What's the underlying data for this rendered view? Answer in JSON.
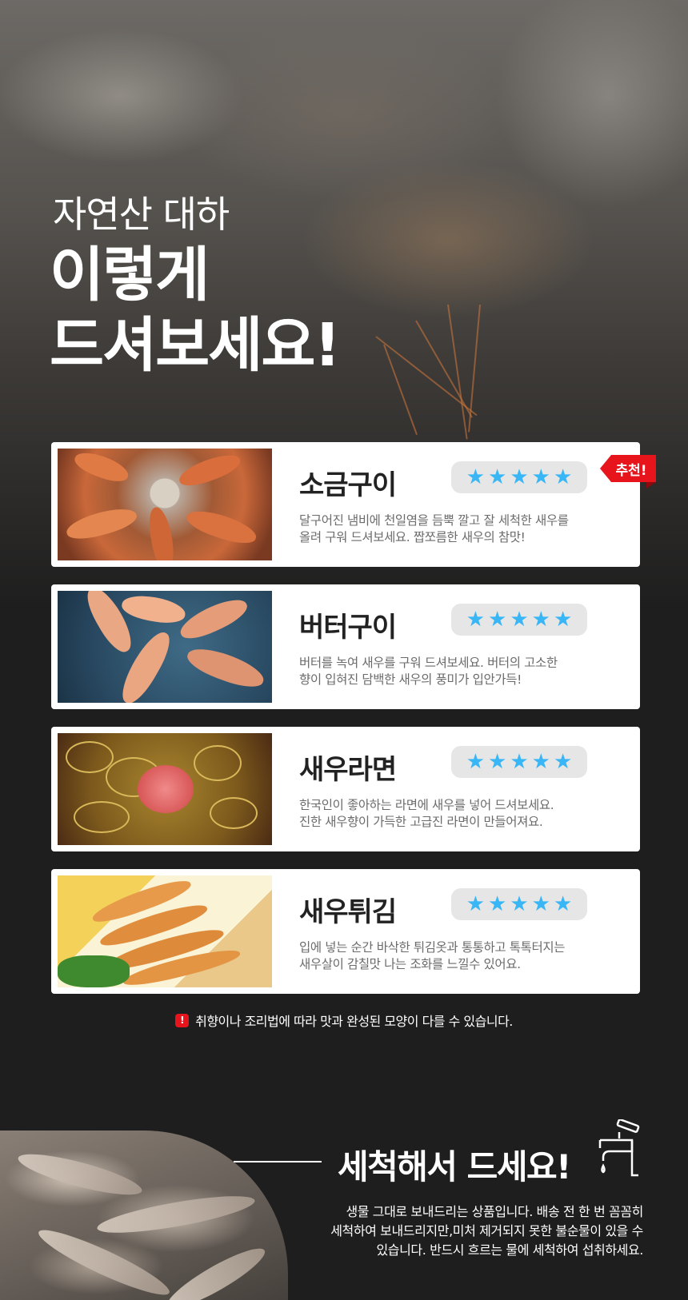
{
  "hero": {
    "subtitle": "자연산 대하",
    "title_line1": "이렇게",
    "title_line2": "드셔보세요!"
  },
  "recipes": [
    {
      "name": "소금구이",
      "rating": 5,
      "description_line1": "달구어진 냄비에 천일염을 듬뿍 깔고 잘 세척한 새우를",
      "description_line2": "올려 구워 드셔보세요. 짭쪼름한 새우의 참맛!",
      "badge": "추천!"
    },
    {
      "name": "버터구이",
      "rating": 5,
      "description_line1": "버터를 녹여 새우를 구워 드셔보세요. 버터의 고소한",
      "description_line2": "향이 입혀진 담백한 새우의 풍미가 입안가득!"
    },
    {
      "name": "새우라면",
      "rating": 5,
      "description_line1": "한국인이 좋아하는 라면에 새우를 넣어 드셔보세요.",
      "description_line2": "진한 새우향이 가득한 고급진 라면이 만들어져요."
    },
    {
      "name": "새우튀김",
      "rating": 5,
      "description_line1": "입에 넣는 순간 바삭한 튀김옷과 통통하고 톡톡터지는",
      "description_line2": "새우살이 감칠맛 나는 조화를 느낄수 있어요."
    }
  ],
  "star_glyph": "★",
  "notice": {
    "icon": "!",
    "text": "취향이나 조리법에 따라 맛과 완성된 모양이 다를 수 있습니다."
  },
  "wash": {
    "title": "세척해서 드세요!",
    "icon": "faucet-icon",
    "description_line1": "생물 그대로 보내드리는 상품입니다. 배송 전 한 번 꼼꼼히",
    "description_line2": "세척하여 보내드리지만,미처 제거되지 못한 불순물이 있을 수",
    "description_line3": "있습니다. 반드시 흐르는 물에 세척하여 섭취하세요."
  },
  "colors": {
    "star": "#38b6f5",
    "badge": "#e8141c",
    "background": "#1e1e1e"
  }
}
